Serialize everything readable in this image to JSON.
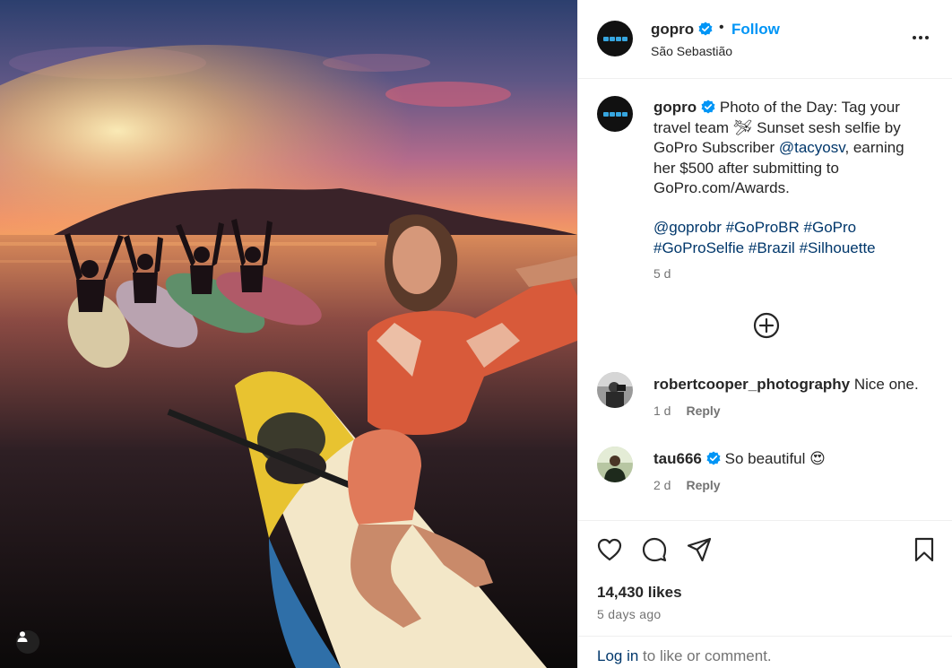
{
  "post": {
    "username": "gopro",
    "follow_label": "Follow",
    "dot": "•",
    "location": "São Sebastião",
    "caption_user": "gopro",
    "caption_part1": "Photo of the Day: Tag your travel team 🛩 Sunset sesh selfie by GoPro Subscriber ",
    "caption_mention": "@tacyosv",
    "caption_part2": ", earning her $500 after submitting to GoPro.com/Awards.",
    "hashtags": [
      "@goprobr",
      "#GoProBR",
      "#GoPro",
      "#GoProSelfie",
      "#Brazil",
      "#Silhouette"
    ],
    "caption_time": "5 d"
  },
  "comments": [
    {
      "user": "robertcooper_photography",
      "verified": false,
      "text": "Nice one.",
      "time": "1 d",
      "reply": "Reply"
    },
    {
      "user": "tau666",
      "verified": true,
      "text": "So beautiful 😍",
      "time": "2 d",
      "reply": "Reply"
    }
  ],
  "stats": {
    "likes": "14,430 likes",
    "date": "5 days ago"
  },
  "login": {
    "link": "Log in",
    "rest": " to like or comment."
  },
  "icons": {
    "verified_color": "#0095f6",
    "brand_blue": "#37a6e0"
  }
}
